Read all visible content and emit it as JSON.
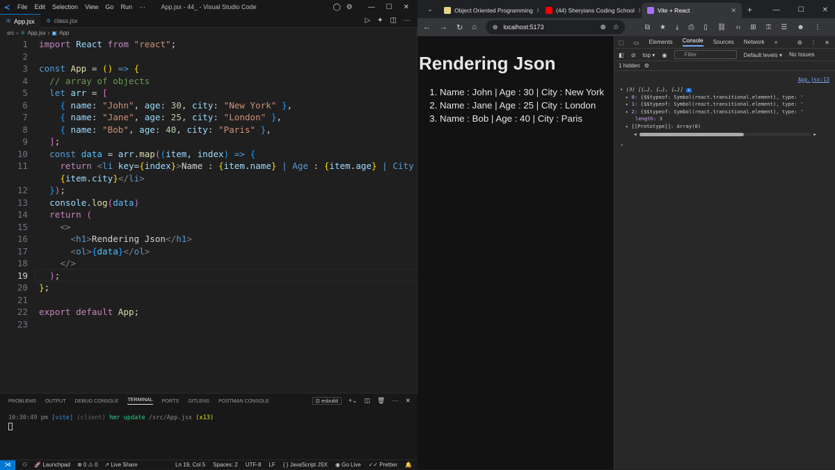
{
  "vscode": {
    "menu": [
      "File",
      "Edit",
      "Selection",
      "View",
      "Go",
      "Run",
      "···"
    ],
    "window_title": "App.jsx - 44_ - Visual Studio Code",
    "tabs": [
      {
        "label": "App.jsx",
        "active": true
      },
      {
        "label": "class.jsx",
        "active": false
      }
    ],
    "breadcrumb": [
      "src",
      "App.jsx",
      "App"
    ],
    "line_numbers": [
      "1",
      "2",
      "3",
      "4",
      "5",
      "6",
      "7",
      "8",
      "9",
      "10",
      "11",
      "",
      "12",
      "13",
      "14",
      "15",
      "16",
      "17",
      "18",
      "19",
      "20",
      "21",
      "22",
      "23"
    ],
    "current_line": "19",
    "panel_tabs": [
      "PROBLEMS",
      "OUTPUT",
      "DEBUG CONSOLE",
      "TERMINAL",
      "PORTS",
      "GITLENS",
      "POSTMAN CONSOLE"
    ],
    "active_panel": "TERMINAL",
    "shell": "esbuild",
    "terminal": {
      "time": "10:30:49 pm",
      "tag": "[vite]",
      "client": "(client)",
      "msg": "hmr update",
      "path": "/src/App.jsx",
      "count": "(x13)"
    },
    "status": {
      "launchpad": "Launchpad",
      "errors": "0",
      "warnings": "0",
      "liveshare": "Live Share",
      "position": "Ln 19, Col 5",
      "spaces": "Spaces: 2",
      "encoding": "UTF-8",
      "eol": "LF",
      "language": "JavaScript JSX",
      "golive": "Go Live",
      "prettier": "Prettier"
    }
  },
  "browser": {
    "tabs": [
      {
        "label": "Object Oriented Programming",
        "color": "#e8d28a"
      },
      {
        "label": "(44) Sheryians Coding School",
        "color": "#ff0000"
      },
      {
        "label": "Vite + React",
        "color": "#a970ff",
        "active": true
      }
    ],
    "url": "localhost:5173",
    "page": {
      "heading": "Rendering Json",
      "items": [
        "Name : John | Age : 30 | City : New York",
        "Name : Jane | Age : 25 | City : London",
        "Name : Bob | Age : 40 | City : Paris"
      ]
    },
    "devtools": {
      "tabs": [
        "Elements",
        "Console",
        "Sources",
        "Network"
      ],
      "active_tab": "Console",
      "context": "top",
      "filter_placeholder": "Filter",
      "levels": "Default levels",
      "issues": "No Issues",
      "hidden": "1 hidden",
      "source_link": "App.jsx:13",
      "summary": "(3) [{…}, {…}, {…}]",
      "entries": [
        {
          "idx": "0:",
          "text": "{$$typeof: Symbol(react.transitional.element), type: '"
        },
        {
          "idx": "1:",
          "text": "{$$typeof: Symbol(react.transitional.element), type: '"
        },
        {
          "idx": "2:",
          "text": "{$$typeof: Symbol(react.transitional.element), type: '"
        }
      ],
      "length": "length: 3",
      "prototype": "[[Prototype]]: Array(0)"
    }
  }
}
